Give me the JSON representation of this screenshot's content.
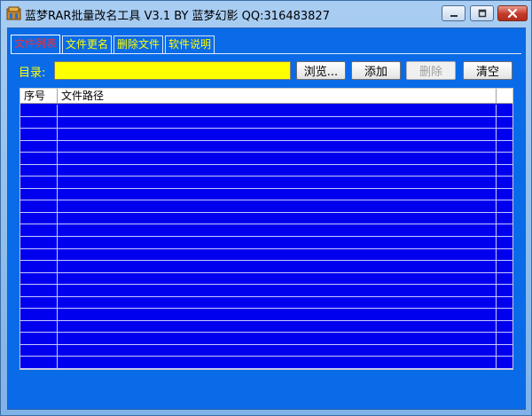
{
  "window": {
    "title": "蓝梦RAR批量改名工具 V3.1 BY 蓝梦幻影 QQ:316483827",
    "icon": "app-folder-icon"
  },
  "titlebar_buttons": {
    "minimize_icon": "minimize-icon",
    "maximize_icon": "maximize-icon",
    "close_icon": "close-icon"
  },
  "tabs": [
    {
      "label": "文件列表",
      "active": true
    },
    {
      "label": "文件更名",
      "active": false
    },
    {
      "label": "删除文件",
      "active": false
    },
    {
      "label": "软件说明",
      "active": false
    }
  ],
  "directory": {
    "label": "目录:",
    "value": ""
  },
  "buttons": {
    "browse": "浏览...",
    "add": "添加",
    "delete": "删除",
    "clear": "清空"
  },
  "list": {
    "columns": [
      "序号",
      "文件路径"
    ],
    "rows": []
  },
  "colors": {
    "accent_blue": "#0a6be8",
    "list_blue": "#0000ee",
    "tab_text": "#ffff00",
    "active_tab_text": "#ff2a2a",
    "input_bg": "#ffff00"
  }
}
